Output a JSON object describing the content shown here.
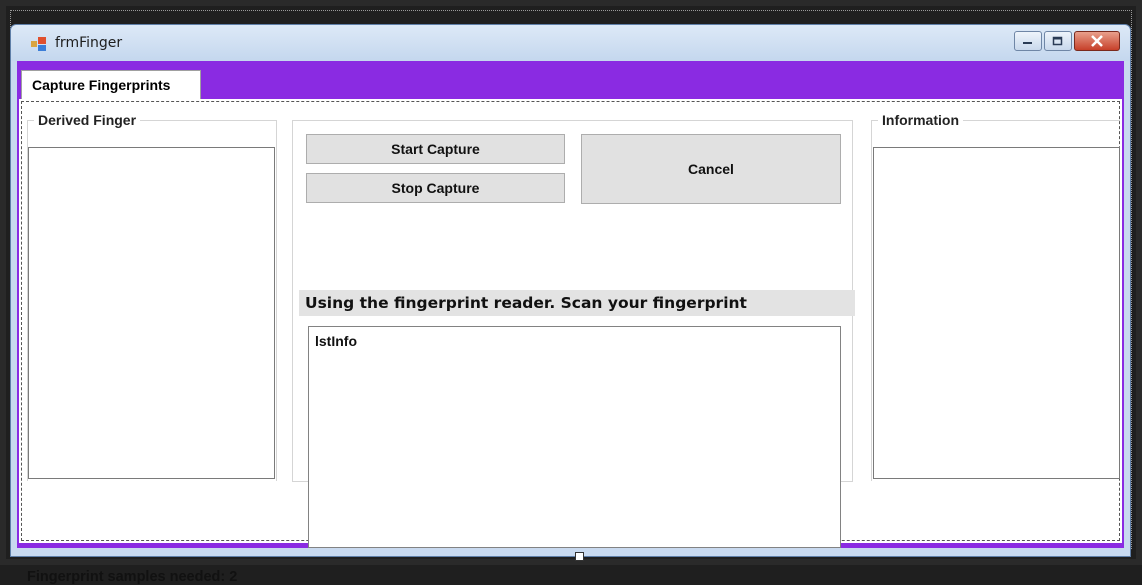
{
  "window": {
    "title": "frmFinger",
    "accent_color": "#8a2be2",
    "icons": [
      "app-icon",
      "minimize-icon",
      "restore-icon",
      "close-icon"
    ]
  },
  "tabs": [
    {
      "label": "Capture Fingerprints",
      "selected": true
    }
  ],
  "derived_finger": {
    "legend": "Derived Finger"
  },
  "information": {
    "legend": "Information"
  },
  "buttons": {
    "start": "Start Capture",
    "stop": "Stop Capture",
    "cancel": "Cancel"
  },
  "prompt": "Using the fingerprint reader. Scan your fingerprint",
  "list": {
    "items": [
      "lstInfo"
    ]
  },
  "status": "Fingerprint samples needed: 2"
}
